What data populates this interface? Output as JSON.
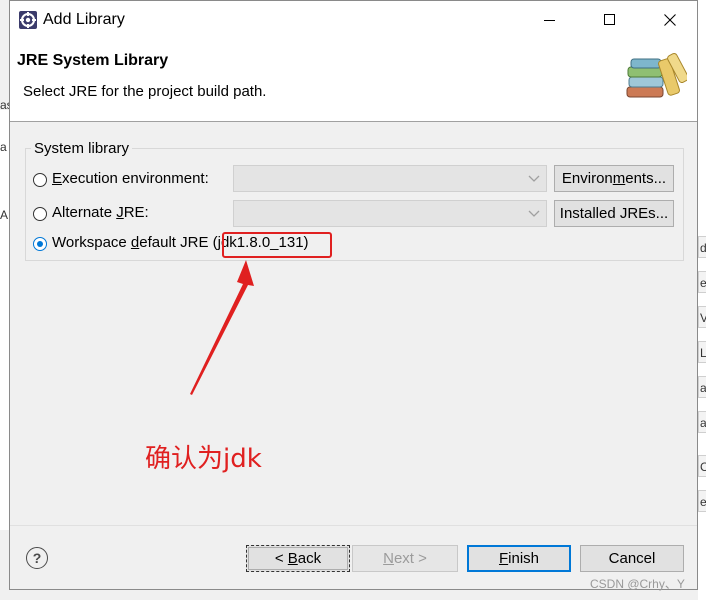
{
  "window": {
    "title": "Add Library",
    "minimize_icon": "minimize-icon",
    "maximize_icon": "maximize-icon",
    "close_icon": "close-icon"
  },
  "header": {
    "title": "JRE System Library",
    "description": "Select JRE for the project build path.",
    "icon": "library-books-icon"
  },
  "group": {
    "label": "System library",
    "options": [
      {
        "prefix": "",
        "underline": "E",
        "suffix": "xecution environment:",
        "checked": false
      },
      {
        "prefix": "Alternate ",
        "underline": "J",
        "suffix": "RE:",
        "checked": false
      },
      {
        "prefix": "Workspace ",
        "underline": "d",
        "suffix": "efault JRE",
        "value": "(jdk1.8.0_131)",
        "checked": true
      }
    ],
    "environments_button": {
      "prefix": "Environ",
      "underline": "m",
      "suffix": "ents..."
    },
    "installed_button": {
      "prefix": "Installed JREs..."
    }
  },
  "annotation": {
    "text": "确认为jdk",
    "color": "#e02020"
  },
  "footer": {
    "help_label": "?",
    "back": {
      "prefix": "< ",
      "underline": "B",
      "suffix": "ack"
    },
    "next": {
      "prefix": "",
      "underline": "N",
      "suffix": "ext >"
    },
    "finish": {
      "prefix": "",
      "underline": "F",
      "suffix": "inish"
    },
    "cancel": "Cancel"
  },
  "background": {
    "left_letters": [
      "a",
      "as",
      "AF"
    ],
    "right_items": [
      "d",
      "e",
      "V",
      "L",
      "as",
      "al",
      "C",
      "er"
    ]
  },
  "watermark": "CSDN @Crhy、Y"
}
